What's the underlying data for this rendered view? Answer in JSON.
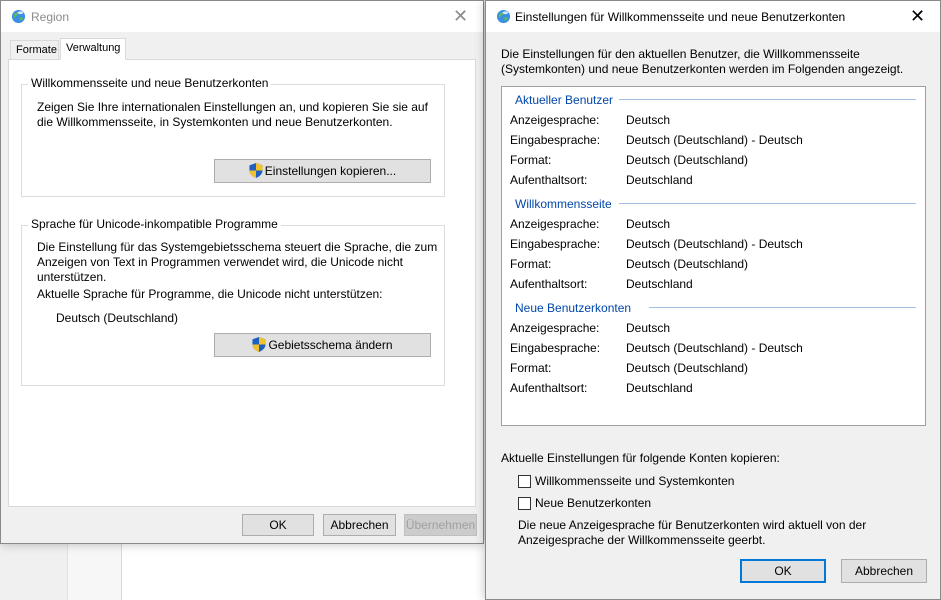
{
  "region_window": {
    "title": "Region",
    "tabs": [
      {
        "label": "Formate"
      },
      {
        "label": "Verwaltung"
      }
    ],
    "group1": {
      "title": "Willkommensseite und neue Benutzerkonten",
      "text_line1": "Zeigen Sie Ihre internationalen Einstellungen an, und kopieren Sie sie auf",
      "text_line2": "die Willkommensseite, in Systemkonten und neue Benutzerkonten.",
      "button": "Einstellungen kopieren..."
    },
    "group2": {
      "title": "Sprache für Unicode-inkompatible Programme",
      "text_line1": "Die Einstellung für das Systemgebietsschema steuert die Sprache, die zum",
      "text_line2": "Anzeigen von Text in Programmen verwendet wird, die Unicode nicht",
      "text_line3": "unterstützen.",
      "current_label": "Aktuelle Sprache für Programme, die Unicode nicht unterstützen:",
      "current_value": "Deutsch (Deutschland)",
      "button": "Gebietsschema ändern"
    },
    "buttons": {
      "ok": "OK",
      "cancel": "Abbrechen",
      "apply": "Übernehmen"
    }
  },
  "settings_window": {
    "title": "Einstellungen für Willkommensseite und neue Benutzerkonten",
    "intro_line1": "Die Einstellungen für den aktuellen Benutzer, die Willkommensseite",
    "intro_line2": "(Systemkonten) und neue Benutzerkonten werden im Folgenden angezeigt.",
    "sections": [
      {
        "title": "Aktueller Benutzer",
        "rows": [
          {
            "label": "Anzeigesprache:",
            "value": "Deutsch"
          },
          {
            "label": "Eingabesprache:",
            "value": "Deutsch (Deutschland) - Deutsch"
          },
          {
            "label": "Format:",
            "value": "Deutsch (Deutschland)"
          },
          {
            "label": "Aufenthaltsort:",
            "value": "Deutschland"
          }
        ]
      },
      {
        "title": "Willkommensseite",
        "rows": [
          {
            "label": "Anzeigesprache:",
            "value": "Deutsch"
          },
          {
            "label": "Eingabesprache:",
            "value": "Deutsch (Deutschland) - Deutsch"
          },
          {
            "label": "Format:",
            "value": "Deutsch (Deutschland)"
          },
          {
            "label": "Aufenthaltsort:",
            "value": "Deutschland"
          }
        ]
      },
      {
        "title": "Neue Benutzerkonten",
        "rows": [
          {
            "label": "Anzeigesprache:",
            "value": "Deutsch"
          },
          {
            "label": "Eingabesprache:",
            "value": "Deutsch (Deutschland) - Deutsch"
          },
          {
            "label": "Format:",
            "value": "Deutsch (Deutschland)"
          },
          {
            "label": "Aufenthaltsort:",
            "value": "Deutschland"
          }
        ]
      }
    ],
    "copy_label": "Aktuelle Einstellungen für folgende Konten kopieren:",
    "checkboxes": [
      {
        "label": "Willkommensseite und Systemkonten",
        "checked": false
      },
      {
        "label": "Neue Benutzerkonten",
        "checked": false
      }
    ],
    "note_line1": "Die neue Anzeigesprache für Benutzerkonten wird aktuell von der",
    "note_line2": "Anzeigesprache der Willkommensseite geerbt.",
    "buttons": {
      "ok": "OK",
      "cancel": "Abbrechen"
    }
  }
}
